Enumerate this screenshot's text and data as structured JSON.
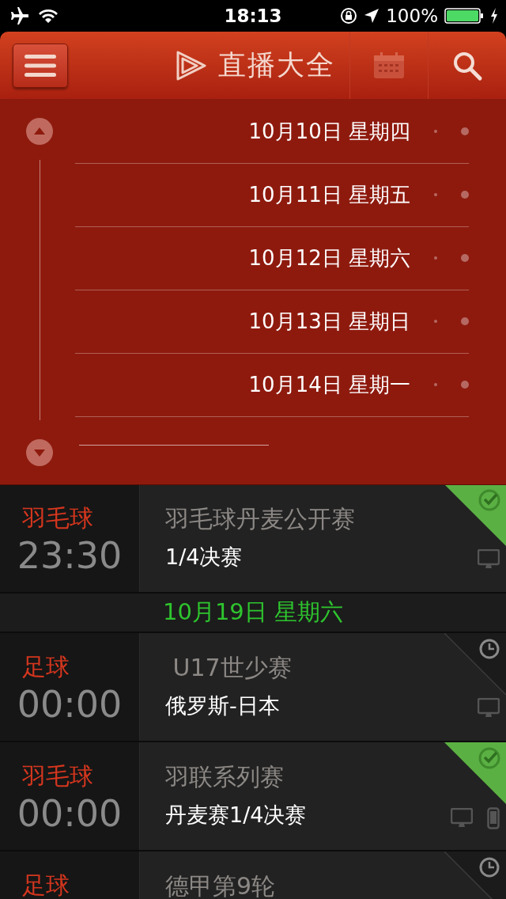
{
  "status_bar": {
    "time": "18:13",
    "battery": "100%"
  },
  "header": {
    "title": "直播大全"
  },
  "date_picker": {
    "dates": [
      {
        "label": "10月10日 星期四"
      },
      {
        "label": "10月11日 星期五"
      },
      {
        "label": "10月12日 星期六"
      },
      {
        "label": "10月13日 星期日"
      },
      {
        "label": "10月14日 星期一"
      }
    ]
  },
  "schedule": [
    {
      "kind": "event",
      "sport": "羽毛球",
      "time": "23:30",
      "title": "羽毛球丹麦公开赛",
      "subtitle": "1/4决赛",
      "reminded": true,
      "tv": true
    },
    {
      "kind": "date",
      "label": "10月19日 星期六"
    },
    {
      "kind": "event",
      "sport": "足球",
      "time": "00:00",
      "title": " U17世少赛",
      "subtitle": "俄罗斯-日本",
      "reminded": false,
      "tv": true
    },
    {
      "kind": "event",
      "sport": "羽毛球",
      "time": "00:00",
      "title": "羽联系列赛",
      "subtitle": "丹麦赛1/4决赛",
      "reminded": true,
      "tv": true,
      "phone": true
    },
    {
      "kind": "event",
      "sport": "足球",
      "title": "德甲第9轮",
      "reminded": false
    }
  ]
}
